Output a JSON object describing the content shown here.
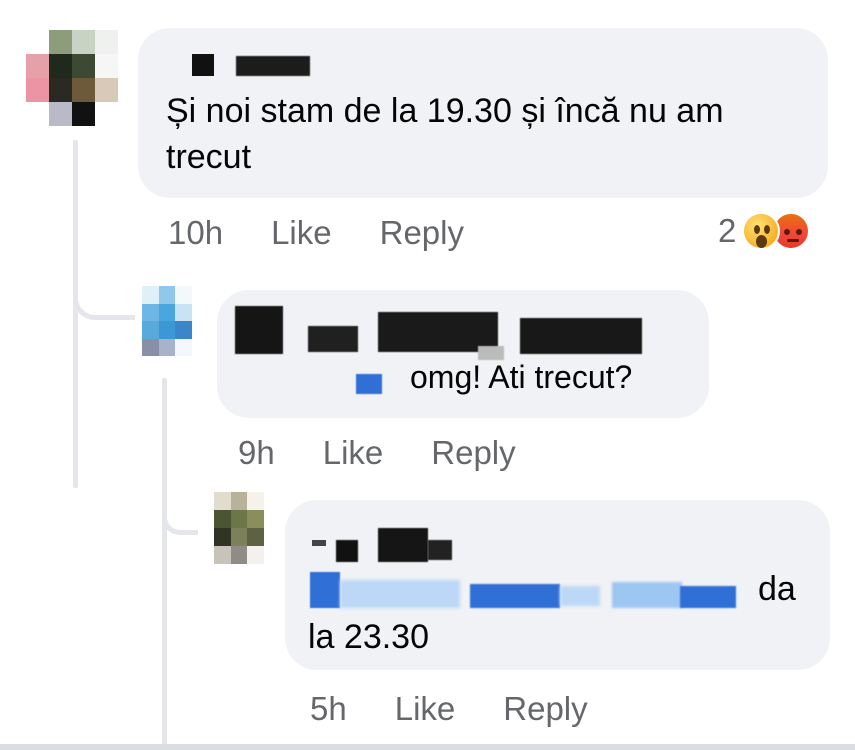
{
  "comments": [
    {
      "author": "",
      "text": "Și noi stam de la 19.30 și încă nu am trecut",
      "time": "10h",
      "like_label": "Like",
      "reply_label": "Reply",
      "reaction_count": "2",
      "reactions": [
        "wow-icon",
        "angry-icon"
      ]
    },
    {
      "author": "",
      "text": "omg! Ati trecut?",
      "time": "9h",
      "like_label": "Like",
      "reply_label": "Reply"
    },
    {
      "author": "",
      "mention": "",
      "text_after_mention": "da",
      "text_line2": "la 23.30",
      "time": "5h",
      "like_label": "Like",
      "reply_label": "Reply"
    }
  ],
  "colors": {
    "bubble": "#f0f2f5",
    "meta_text": "#65676b",
    "thread_line": "#e4e6eb",
    "mention": "#1877f2"
  }
}
